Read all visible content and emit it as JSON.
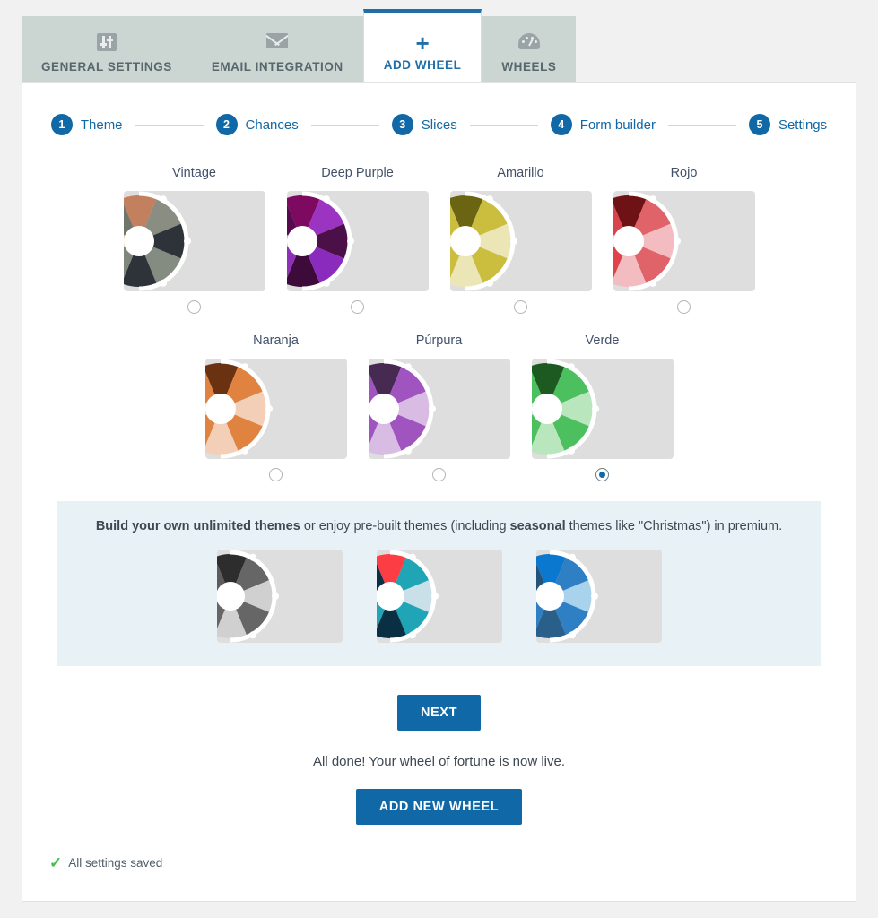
{
  "tabs": [
    {
      "label": "GENERAL SETTINGS",
      "icon": "sliders-icon",
      "active": false
    },
    {
      "label": "EMAIL INTEGRATION",
      "icon": "mail-icon",
      "active": false
    },
    {
      "label": "ADD WHEEL",
      "icon": "plus-icon",
      "active": true
    },
    {
      "label": "WHEELS",
      "icon": "gauge-icon",
      "active": false
    }
  ],
  "stepper": {
    "steps": [
      {
        "num": "1",
        "label": "Theme"
      },
      {
        "num": "2",
        "label": "Chances"
      },
      {
        "num": "3",
        "label": "Slices"
      },
      {
        "num": "4",
        "label": "Form builder"
      },
      {
        "num": "5",
        "label": "Settings"
      }
    ]
  },
  "themes_row1": [
    {
      "name": "Vintage",
      "selected": false,
      "colors": [
        "#c3805f",
        "#8a8d82",
        "#2e3239",
        "#848b80",
        "#2e3239",
        "#7f867c",
        "#e2cfa2",
        "#6f766b"
      ]
    },
    {
      "name": "Deep Purple",
      "selected": false,
      "colors": [
        "#7d0a60",
        "#9b34c0",
        "#4b1048",
        "#8a2bbd",
        "#3d0b3a",
        "#8e31b8",
        "#cb94e2",
        "#570b4e"
      ]
    },
    {
      "name": "Amarillo",
      "selected": false,
      "colors": [
        "#6b6412",
        "#cbbe3f",
        "#ece6b6",
        "#cbbe3f",
        "#ece6b6",
        "#cbbe3f",
        "#ece6b6",
        "#cbbe3f"
      ]
    },
    {
      "name": "Rojo",
      "selected": false,
      "colors": [
        "#6e1216",
        "#e1636a",
        "#f3bcc0",
        "#e1636a",
        "#f3bcc0",
        "#e04249",
        "#f3bcc0",
        "#d9434b"
      ]
    }
  ],
  "themes_row2": [
    {
      "name": "Naranja",
      "selected": false,
      "colors": [
        "#6b3212",
        "#e08340",
        "#f2cfb6",
        "#e08340",
        "#f2cfb6",
        "#e08340",
        "#f2cfb6",
        "#e08340"
      ]
    },
    {
      "name": "Púrpura",
      "selected": false,
      "colors": [
        "#462a52",
        "#a054c0",
        "#d9bce4",
        "#a054c0",
        "#d9bce4",
        "#a054c0",
        "#d9bce4",
        "#a054c0"
      ]
    },
    {
      "name": "Verde",
      "selected": true,
      "colors": [
        "#1d5a22",
        "#4cbf5e",
        "#b9e6bd",
        "#4cbf5e",
        "#b9e6bd",
        "#4cbf5e",
        "#b9e6bd",
        "#4cbf5e"
      ]
    }
  ],
  "promo": {
    "text_bold_1": "Build your own unlimited themes",
    "text_mid_1": " or enjoy pre-built themes (including ",
    "text_bold_2": "seasonal",
    "text_mid_2": " themes like \"Christmas\") in premium.",
    "wheels": [
      {
        "name": "premium-grayscale",
        "colors": [
          "#2d2d2d",
          "#666666",
          "#d0d0d0",
          "#666666",
          "#d0d0d0",
          "#666666",
          "#b5b5b5",
          "#5c5c5c"
        ]
      },
      {
        "name": "premium-teal-red",
        "colors": [
          "#fc3d44",
          "#1fa5b5",
          "#c9e0e8",
          "#1fa5b5",
          "#0a2f42",
          "#1fa5b5",
          "#c9e0e8",
          "#0a2f42"
        ]
      },
      {
        "name": "premium-blue",
        "colors": [
          "#0b78d0",
          "#2f7fc4",
          "#a9d2ed",
          "#2f7fc4",
          "#2a5f89",
          "#2f7fc4",
          "#a9d2ed",
          "#24537a"
        ]
      }
    ]
  },
  "buttons": {
    "next": "NEXT",
    "add_new_wheel": "ADD NEW WHEEL"
  },
  "messages": {
    "all_done": "All done! Your wheel of fortune is now live.",
    "saved": "All settings saved"
  },
  "colors": {
    "accent": "#1168a6",
    "tab_inactive_bg": "#cbd6d3",
    "promo_bg": "#e8f1f5",
    "page_bg": "#f1f1f1",
    "wheel_box_bg": "#dedede",
    "success": "#3fbf4a"
  }
}
